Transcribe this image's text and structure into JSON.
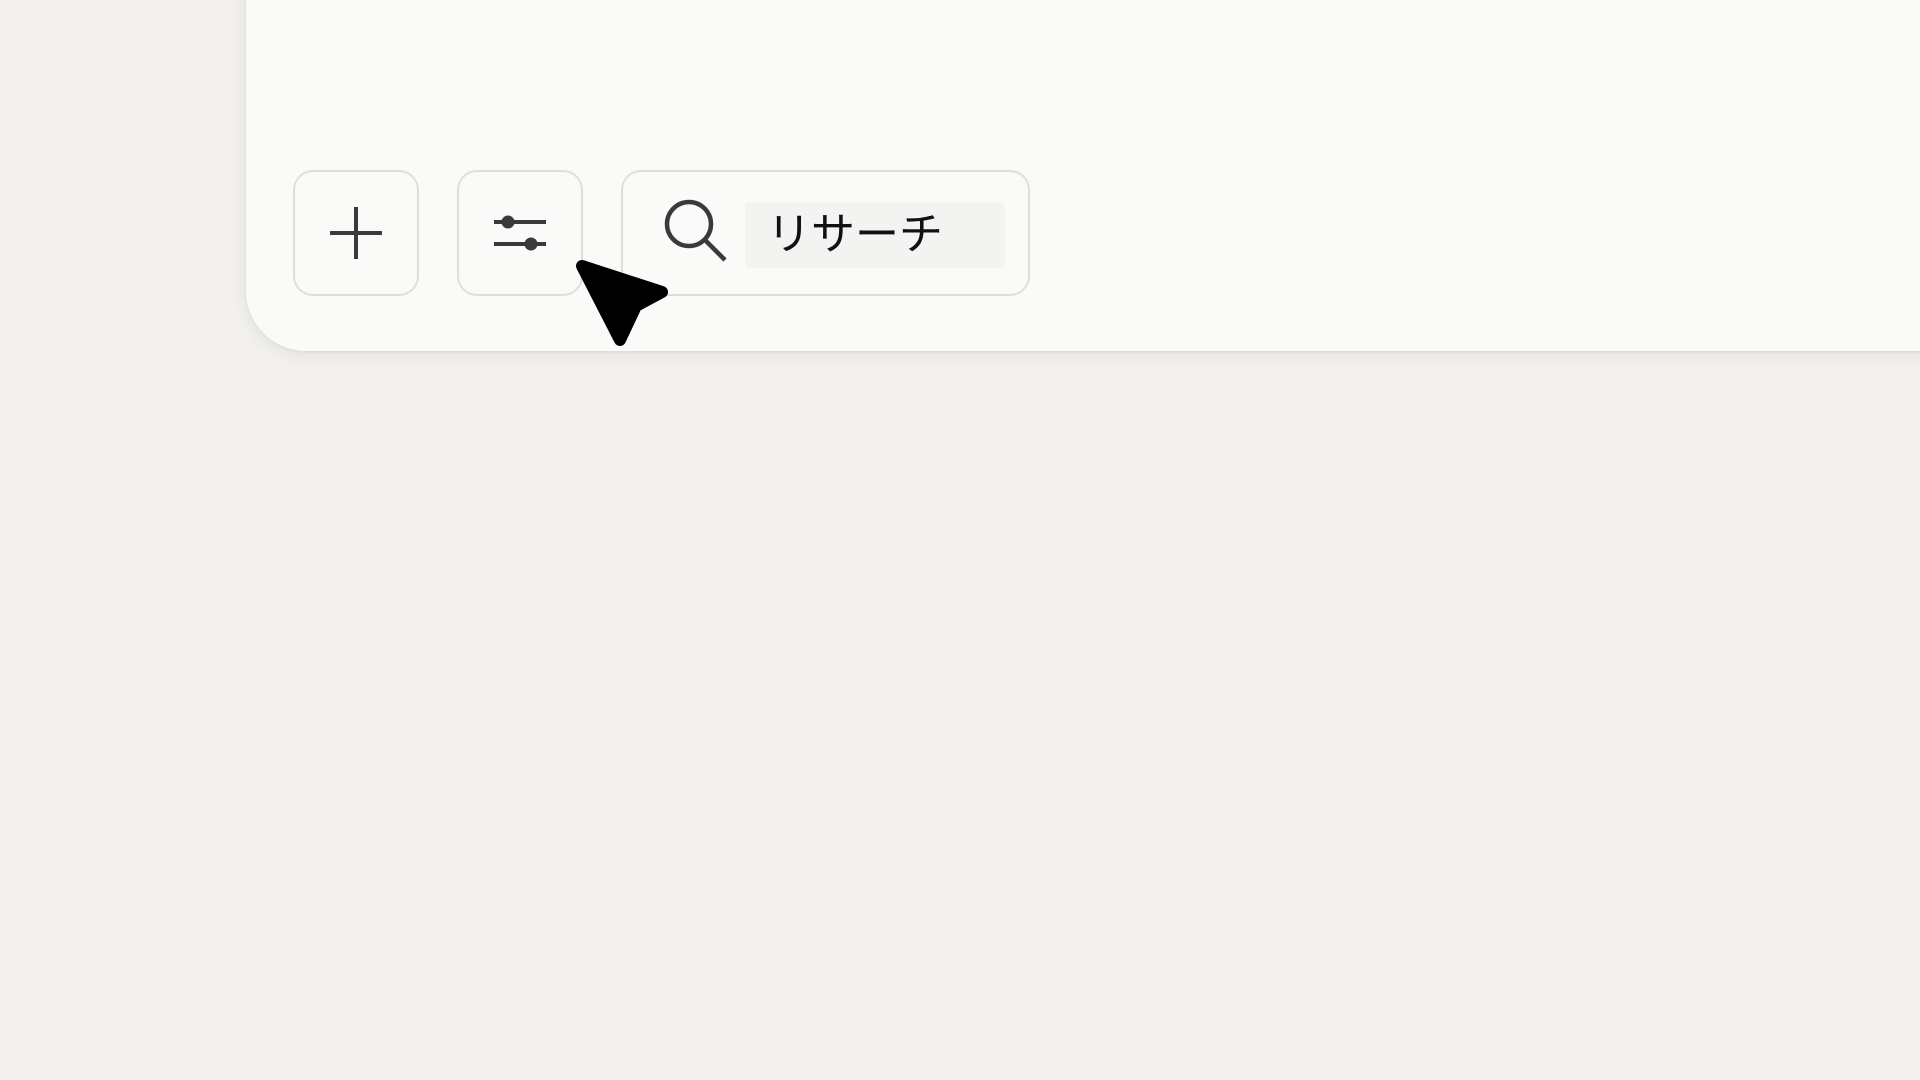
{
  "toolbar": {
    "add_icon": "plus-icon",
    "filter_icon": "sliders-icon",
    "search": {
      "icon": "search-icon",
      "value": "リサーチ"
    }
  },
  "cursor": {
    "icon": "arrow-pointer-icon"
  },
  "colors": {
    "background": "#f3f1ed",
    "panel": "#fafaf8",
    "border": "#dededb",
    "icon": "#3a3a3a",
    "cursor": "#000000"
  }
}
